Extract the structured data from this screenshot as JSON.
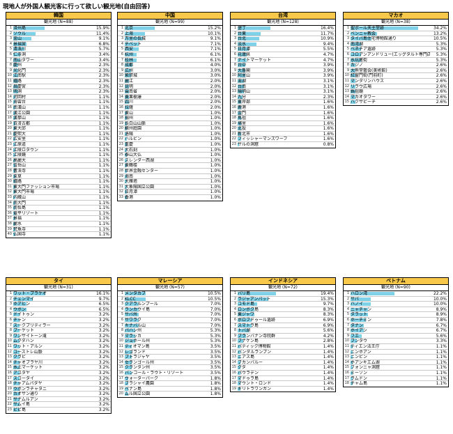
{
  "title": "現地人が外国人観光客に行って欲しい観光地(自由回答)",
  "tables": [
    {
      "country": "韓国",
      "subtitle": "観光地 (N=88)",
      "rows": [
        [
          "済州島",
          "15.9%"
        ],
        [
          "ソウル",
          "11.4%"
        ],
        [
          "釜山",
          "9.1%"
        ],
        [
          "景福宮",
          "6.8%"
        ],
        [
          "清渓川",
          "5.7%"
        ],
        [
          "仁寺洞",
          "3.4%"
        ],
        [
          "南山タワー",
          "3.4%"
        ],
        [
          "慶州",
          "2.3%"
        ],
        [
          "光化門",
          "2.3%"
        ],
        [
          "江南駅",
          "2.3%"
        ],
        [
          "鍾路",
          "2.3%"
        ],
        [
          "昌慶宮",
          "2.3%"
        ],
        [
          "明洞",
          "2.3%"
        ],
        [
          "河回村",
          "1.1%"
        ],
        [
          "海雲台",
          "1.1%"
        ],
        [
          "南漢山",
          "1.1%"
        ],
        [
          "漢江公園",
          "1.1%"
        ],
        [
          "漢拏山",
          "1.1%"
        ],
        [
          "百済古都",
          "1.1%"
        ],
        [
          "東大邱",
          "1.1%"
        ],
        [
          "慶熙大",
          "1.1%"
        ],
        [
          "広安里",
          "1.1%"
        ],
        [
          "江原道",
          "1.1%"
        ],
        [
          "江陵ロタウン",
          "1.1%"
        ],
        [
          "江陵鏡",
          "1.1%"
        ],
        [
          "高麗大",
          "1.1%"
        ],
        [
          "雪岳山",
          "1.1%"
        ],
        [
          "曹渓寺",
          "1.1%"
        ],
        [
          "束草",
          "1.1%"
        ],
        [
          "鍾路",
          "1.1%"
        ],
        [
          "東大門ファッション市場",
          "1.1%"
        ],
        [
          "東大門市場",
          "1.1%"
        ],
        [
          "内蔵山",
          "1.1%"
        ],
        [
          "南大門",
          "1.1%"
        ],
        [
          "南怡島",
          "1.1%"
        ],
        [
          "竜平リゾート",
          "1.1%"
        ],
        [
          "景福",
          "1.1%"
        ],
        [
          "麗水",
          "1.1%"
        ],
        [
          "梵魚寺",
          "1.1%"
        ],
        [
          "仏国寺",
          "1.1%"
        ]
      ]
    },
    {
      "country": "中国",
      "subtitle": "観光地 (N=99)",
      "rows": [
        [
          "北京",
          "15.2%"
        ],
        [
          "上海",
          "10.1%"
        ],
        [
          "万里の長城",
          "9.1%"
        ],
        [
          "チベット",
          "7.1%"
        ],
        [
          "西安",
          "7.1%"
        ],
        [
          "杭州",
          "6.1%"
        ],
        [
          "桂林",
          "6.1%"
        ],
        [
          "成都",
          "4.0%"
        ],
        [
          "広州",
          "3.0%"
        ],
        [
          "紫禁城",
          "3.0%"
        ],
        [
          "麗江",
          "2.0%"
        ],
        [
          "昆明",
          "2.0%"
        ],
        [
          "雲南省",
          "2.0%"
        ],
        [
          "黄果樹瀑",
          "2.0%"
        ],
        [
          "四川",
          "2.0%"
        ],
        [
          "拉薩",
          "2.0%"
        ],
        [
          "黄山",
          "1.0%"
        ],
        [
          "揚州",
          "1.0%"
        ],
        [
          "長白山山脈",
          "1.0%"
        ],
        [
          "蘇州庭園",
          "1.0%"
        ],
        [
          "洛陽",
          "1.0%"
        ],
        [
          "ハルビン",
          "1.0%"
        ],
        [
          "重慶",
          "1.0%"
        ],
        [
          "大石刻",
          "1.0%"
        ],
        [
          "泰山大仏",
          "1.0%"
        ],
        [
          "スレンダー西湖",
          "1.0%"
        ],
        [
          "黄鶴楼",
          "1.0%"
        ],
        [
          "世界金融センター",
          "1.0%"
        ],
        [
          "海南",
          "1.0%"
        ],
        [
          "大雁塔",
          "1.0%"
        ],
        [
          "大象陽国立公園",
          "1.0%"
        ],
        [
          "日月潭",
          "1.0%"
        ],
        [
          "香港",
          "1.0%"
        ]
      ]
    },
    {
      "country": "台湾",
      "subtitle": "観光地 (N=128)",
      "rows": [
        [
          "墾丁",
          "16.4%"
        ],
        [
          "台東",
          "11.7%"
        ],
        [
          "台北",
          "10.9%"
        ],
        [
          "淡水",
          "9.4%"
        ],
        [
          "日月潭",
          "5.5%"
        ],
        [
          "花蓮県",
          "4.7%"
        ],
        [
          "ナイトマーケット",
          "4.7%"
        ],
        [
          "台中",
          "3.9%"
        ],
        [
          "大魯閣",
          "3.9%"
        ],
        [
          "阿里山",
          "3.9%"
        ],
        [
          "澎湖",
          "3.1%"
        ],
        [
          "台南",
          "3.1%"
        ],
        [
          "陽明山",
          "3.1%"
        ],
        [
          "九分",
          "2.3%"
        ],
        [
          "東岸部",
          "1.6%"
        ],
        [
          "鹿港",
          "1.6%"
        ],
        [
          "金門",
          "1.6%"
        ],
        [
          "馬祖",
          "1.6%"
        ],
        [
          "埔里",
          "1.6%"
        ],
        [
          "北投",
          "1.6%"
        ],
        [
          "新北市",
          "1.6%"
        ],
        [
          "フィッシャーマンズワーフ",
          "1.6%"
        ],
        [
          "サルの洞窟",
          "0.8%"
        ]
      ]
    },
    {
      "country": "マカオ",
      "subtitle": "観光地 (N=38)",
      "rows": [
        [
          "聖ポール天主堂跡",
          "34.2%"
        ],
        [
          "ベンニャ教会",
          "13.2%"
        ],
        [
          "タイパ島住宅博物館通り",
          "10.5%"
        ],
        [
          "南湾湖",
          "5.3%"
        ],
        [
          "ベネチア遺跡",
          "5.3%"
        ],
        [
          "コロアンアンドリュー(エッグタルト専門店)",
          "5.3%"
        ],
        [
          "水坑尾街",
          "5.3%"
        ],
        [
          "カジノ",
          "2.6%"
        ],
        [
          "大熊堂藝会(美術館)",
          "2.6%"
        ],
        [
          "紅窗門街(門前町)",
          "2.6%"
        ],
        [
          "マンダリンハウス",
          "2.6%"
        ],
        [
          "リラウ広場",
          "2.6%"
        ],
        [
          "媽祖廟",
          "2.6%"
        ],
        [
          "マカオタワー",
          "2.6%"
        ],
        [
          "ハクサビーチ",
          "2.6%"
        ]
      ]
    },
    {
      "country": "タイ",
      "subtitle": "観光地 (N=31)",
      "rows": [
        [
          "ワット・プラケオ",
          "16.1%"
        ],
        [
          "チェンマイ",
          "9.7%"
        ],
        [
          "ホアヒン",
          "6.5%"
        ],
        [
          "ウボン",
          "6.5%"
        ],
        [
          "ドイトゥン",
          "3.2%"
        ],
        [
          "チャン",
          "3.2%"
        ],
        [
          "スークプリティラー",
          "3.2%"
        ],
        [
          "プーケット",
          "3.2%"
        ],
        [
          "ワンサイトーン滝",
          "3.2%"
        ],
        [
          "ムクダハン",
          "3.2%"
        ],
        [
          "ワット・アルン",
          "3.2%"
        ],
        [
          "コーストレ山脈",
          "3.2%"
        ],
        [
          "クラビ",
          "3.2%"
        ],
        [
          "チャオプラヤ川",
          "3.2%"
        ],
        [
          "水上マーケット",
          "3.2%"
        ],
        [
          "アユタヤ",
          "3.2%"
        ],
        [
          "スコータイ",
          "3.2%"
        ],
        [
          "チャアムパタヤ",
          "3.2%"
        ],
        [
          "ウボンラチャタニ",
          "3.2%"
        ],
        [
          "カオサン通り",
          "3.2%"
        ],
        [
          "サナムルアン",
          "3.2%"
        ],
        [
          "サムイ島",
          "3.2%"
        ],
        [
          "ピピ島",
          "3.2%"
        ]
      ]
    },
    {
      "country": "マレーシア",
      "subtitle": "観光地 (N=57)",
      "rows": [
        [
          "メンタカブ",
          "10.5%"
        ],
        [
          "KLCC",
          "10.5%"
        ],
        [
          "クアラルンプール",
          "7.0%"
        ],
        [
          "ランカウイ島",
          "7.0%"
        ],
        [
          "サバ州",
          "7.0%"
        ],
        [
          "サワラク",
          "7.0%"
        ],
        [
          "キナバル山",
          "7.0%"
        ],
        [
          "パハン州",
          "5.3%"
        ],
        [
          "マラッカ",
          "5.3%"
        ],
        [
          "ジョホール州",
          "5.3%"
        ],
        [
          "ティオマン島",
          "3.5%"
        ],
        [
          "レゴランド",
          "3.5%"
        ],
        [
          "プトラジャヤ",
          "3.5%"
        ],
        [
          "セランゴール州",
          "3.5%"
        ],
        [
          "クランタン州",
          "3.5%"
        ],
        [
          "バンコール・ラウト・リゾート",
          "3.5%"
        ],
        [
          "ウォーターパーク",
          "1.8%"
        ],
        [
          "ブラシャイ農園",
          "1.8%"
        ],
        [
          "ペナン島",
          "1.8%"
        ],
        [
          "ムル国立公園",
          "1.8%"
        ]
      ]
    },
    {
      "country": "インドネシア",
      "subtitle": "観光地 (N=72)",
      "rows": [
        [
          "バリ島",
          "19.4%"
        ],
        [
          "ラジャアンパット",
          "15.3%"
        ],
        [
          "コモド島",
          "9.7%"
        ],
        [
          "ロンボク島",
          "8.3%"
        ],
        [
          "東ジャワ",
          "8.3%"
        ],
        [
          "ボロブドゥール遺跡",
          "6.9%"
        ],
        [
          "スマトラ島",
          "6.9%"
        ],
        [
          "トバ湖",
          "5.6%"
        ],
        [
          "プランバナン寺院群",
          "4.2%"
        ],
        [
          "ブナケン島",
          "2.8%"
        ],
        [
          "バティック博物館",
          "1.4%"
        ],
        [
          "バンダルランプン",
          "1.4%"
        ],
        [
          "ニアス島",
          "1.4%"
        ],
        [
          "ブカンバルー",
          "1.4%"
        ],
        [
          "クタ",
          "1.4%"
        ],
        [
          "パウラデン",
          "1.4%"
        ],
        [
          "マドゥラ島",
          "1.4%"
        ],
        [
          "マウント・ロンド",
          "1.4%"
        ],
        [
          "ギリトラワンガン",
          "1.4%"
        ]
      ]
    },
    {
      "country": "ベトナム",
      "subtitle": "観光地 (N=90)",
      "rows": [
        [
          "ハロン湾",
          "22.2%"
        ],
        [
          "サパ",
          "10.0%"
        ],
        [
          "ハノイ",
          "10.0%"
        ],
        [
          "ニャチャン",
          "8.9%"
        ],
        [
          "ダラット",
          "8.9%"
        ],
        [
          "ホーチミン",
          "7.8%"
        ],
        [
          "ダナン",
          "6.7%"
        ],
        [
          "ホイアン",
          "6.7%"
        ],
        [
          "フエ",
          "5.6%"
        ],
        [
          "ブンタウ",
          "3.3%"
        ],
        [
          "ティエン法王庁",
          "1.1%"
        ],
        [
          "ニンホアン",
          "1.1%"
        ],
        [
          "ニンビン",
          "1.1%"
        ],
        [
          "ホアンキエム湖",
          "1.1%"
        ],
        [
          "フォンニャ洞窟",
          "1.1%"
        ],
        [
          "ミーソン",
          "1.1%"
        ],
        [
          "ラムドン",
          "1.1%"
        ],
        [
          "チャム島",
          "1.1%"
        ]
      ]
    }
  ]
}
